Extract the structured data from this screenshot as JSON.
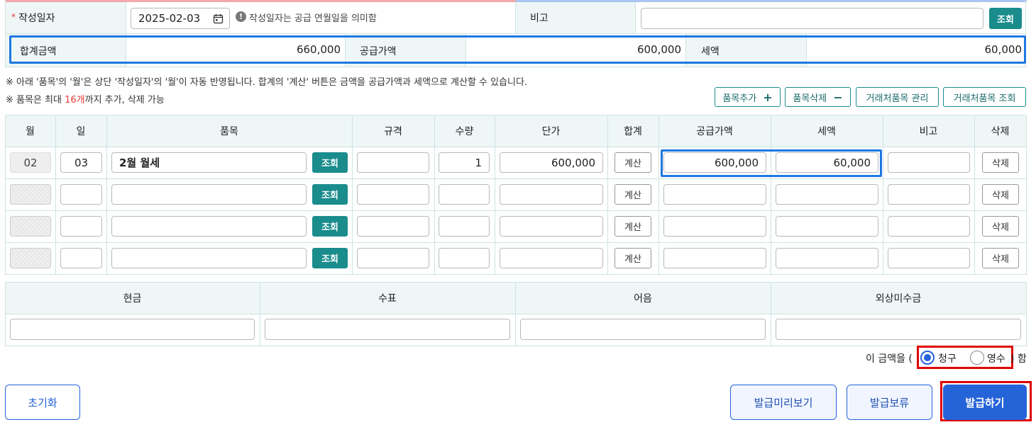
{
  "header": {
    "date_label": "작성일자",
    "date_required_mark": "*",
    "date_value": "2025-02-03",
    "date_hint": "작성일자는 공급 연월일을 의미함",
    "memo_label": "비고",
    "memo_value": "",
    "lookup_label": "조회"
  },
  "totals": {
    "total_label": "합계금액",
    "total_value": "660,000",
    "supply_label": "공급가액",
    "supply_value": "600,000",
    "tax_label": "세액",
    "tax_value": "60,000"
  },
  "notes": {
    "line1": "※ 아래 '품목'의 '월'은 상단 '작성일자'의 '월'이 자동 반영됩니다. 합계의 '계산' 버튼은 금액을 공급가액과 세액으로 계산할 수 있습니다.",
    "line2_prefix": "※ 품목은 최대 ",
    "line2_highlight": "16개",
    "line2_suffix": "까지 추가, 삭제 가능"
  },
  "item_actions": {
    "add_label": "품목추가",
    "add_symbol": "+",
    "delete_label": "품목삭제",
    "delete_symbol": "−",
    "manage_label": "거래처품목 관리",
    "lookup_label": "거래처품목 조회"
  },
  "items_table": {
    "headers": [
      "월",
      "일",
      "품목",
      "규격",
      "수량",
      "단가",
      "합계",
      "공급가액",
      "세액",
      "비고",
      "삭제"
    ],
    "lookup_label": "조회",
    "calc_label": "계산",
    "delete_label": "삭제",
    "rows": [
      {
        "month": "02",
        "day": "03",
        "item": "2월 월세",
        "spec": "",
        "qty": "1",
        "unit_price": "600,000",
        "supply": "600,000",
        "tax": "60,000",
        "memo": ""
      },
      {
        "month": "",
        "day": "",
        "item": "",
        "spec": "",
        "qty": "",
        "unit_price": "",
        "supply": "",
        "tax": "",
        "memo": ""
      },
      {
        "month": "",
        "day": "",
        "item": "",
        "spec": "",
        "qty": "",
        "unit_price": "",
        "supply": "",
        "tax": "",
        "memo": ""
      },
      {
        "month": "",
        "day": "",
        "item": "",
        "spec": "",
        "qty": "",
        "unit_price": "",
        "supply": "",
        "tax": "",
        "memo": ""
      }
    ]
  },
  "payment_table": {
    "headers": [
      "현금",
      "수표",
      "어음",
      "외상미수금"
    ],
    "values": [
      "",
      "",
      "",
      ""
    ]
  },
  "receipt_type": {
    "prefix": "이 금액을 (",
    "option_claim": "청구",
    "option_receipt": "영수",
    "suffix": ") 함",
    "selected": "청구"
  },
  "footer": {
    "reset_label": "초기화",
    "preview_label": "발급미리보기",
    "hold_label": "발급보류",
    "issue_label": "발급하기"
  },
  "colors": {
    "teal": "#1a8c8c",
    "highlight_blue": "#1e78e0",
    "primary_blue": "#2563d9",
    "required_red": "#e53935",
    "annotation_red": "#e00000"
  }
}
